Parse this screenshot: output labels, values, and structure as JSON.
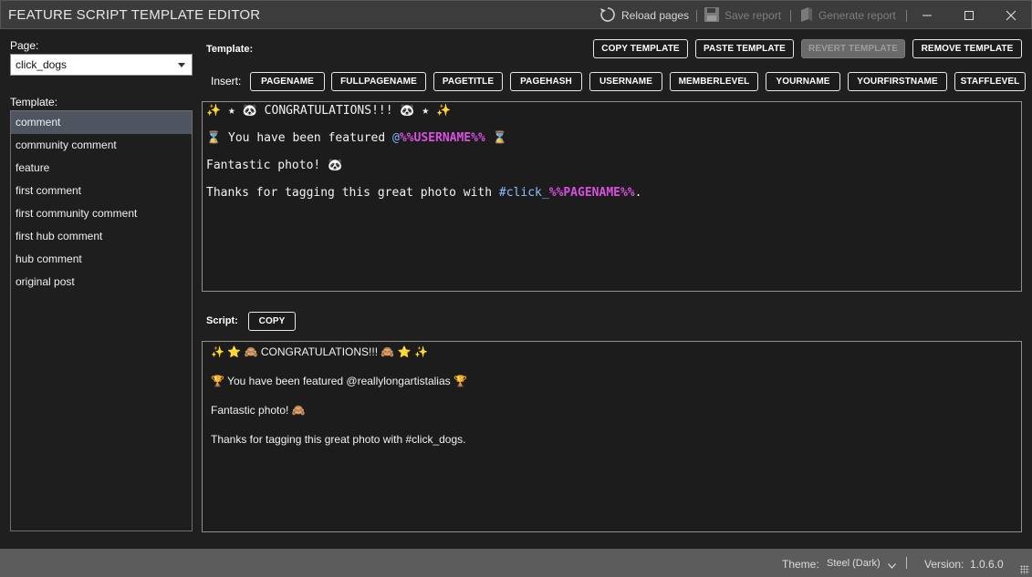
{
  "window": {
    "title": "FEATURE SCRIPT TEMPLATE EDITOR",
    "actions": {
      "reload": "Reload pages",
      "save_report": "Save report",
      "generate_report": "Generate report"
    }
  },
  "left": {
    "page_label": "Page:",
    "page_value": "click_dogs",
    "template_label": "Template:",
    "templates": [
      "comment",
      "community comment",
      "feature",
      "first comment",
      "first community comment",
      "first hub comment",
      "hub comment",
      "original post"
    ],
    "selected_template": "comment"
  },
  "template_panel": {
    "label": "Template:",
    "buttons": {
      "copy": "COPY TEMPLATE",
      "paste": "PASTE TEMPLATE",
      "revert": "REVERT TEMPLATE",
      "remove": "REMOVE TEMPLATE"
    },
    "insert_label": "Insert:",
    "insert_tokens": [
      "PAGENAME",
      "FULLPAGENAME",
      "PAGETITLE",
      "PAGEHASH",
      "USERNAME",
      "MEMBERLEVEL",
      "YOURNAME",
      "YOURFIRSTNAME",
      "STAFFLEVEL"
    ],
    "lines": {
      "l1": "✨ ★ 🐼 CONGRATULATIONS!!! 🐼 ★ ✨",
      "l2_a": "⌛ You have been featured ",
      "l2_at": "@",
      "l2_var": "%%USERNAME%%",
      "l2_b": " ⌛",
      "l3": "Fantastic photo! 🐼",
      "l4_a": "Thanks for tagging this great photo with ",
      "l4_hash": "#click_",
      "l4_var": "%%PAGENAME%%",
      "l4_b": "."
    }
  },
  "script_panel": {
    "label": "Script:",
    "copy_button": "COPY",
    "lines": [
      "✨ ⭐ 🙈 CONGRATULATIONS!!! 🙈 ⭐ ✨",
      "🏆 You have been featured @reallylongartistalias 🏆",
      "Fantastic photo! 🙈",
      "Thanks for tagging this great photo with #click_dogs."
    ]
  },
  "status": {
    "theme_label": "Theme:",
    "theme_value": "Steel (Dark)",
    "version_label": "Version:",
    "version_value": "1.0.6.0"
  },
  "colors": {
    "background": "#1f1f1f",
    "titlebar": "#3c3c3c",
    "statusbar": "#5c5c5c",
    "selected_item": "#4f5560",
    "token_variable": "#d94fe0",
    "token_link": "#7fb4ff"
  },
  "icons": {
    "reload": "reload-icon",
    "save": "save-icon",
    "generate": "report-icon",
    "minimize": "minimize-icon",
    "maximize": "maximize-icon",
    "close": "close-icon",
    "dropdown": "chevron-down-icon"
  }
}
